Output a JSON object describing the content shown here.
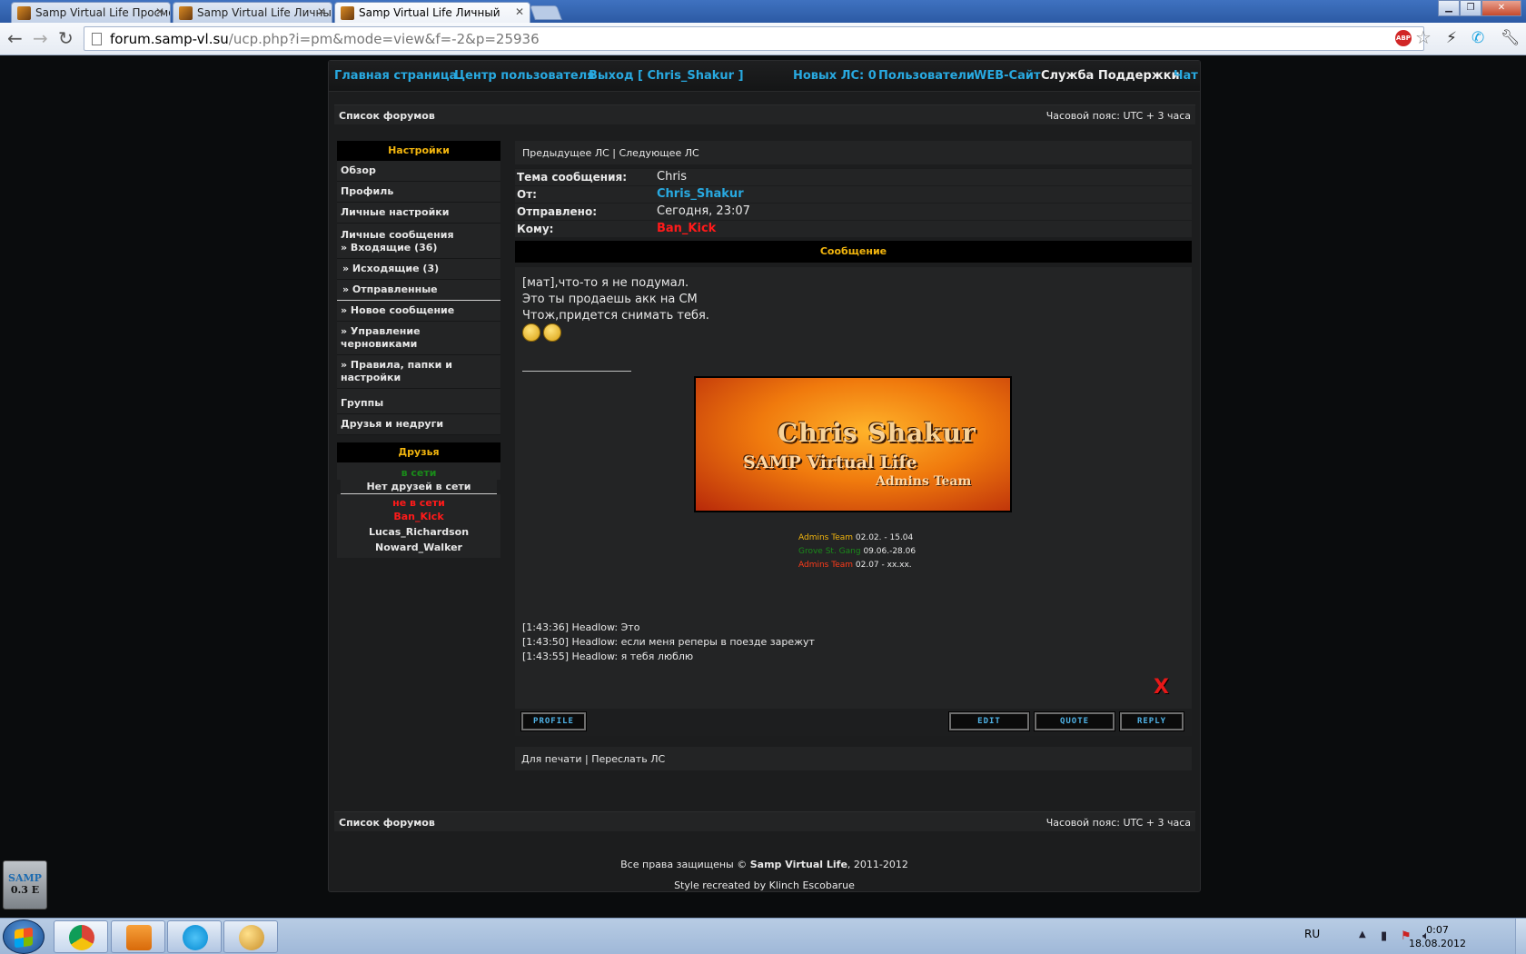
{
  "browser": {
    "tabs": [
      {
        "title": "Samp Virtual Life Просмот",
        "active": false
      },
      {
        "title": "Samp Virtual Life Личный",
        "active": false
      },
      {
        "title": "Samp Virtual Life Личный",
        "active": true
      }
    ],
    "url_host": "forum.samp-vl.su",
    "url_path": "/ucp.php?i=pm&mode=view&f=-2&p=25936",
    "abp_label": "ABP"
  },
  "topnav": {
    "home": "Главная страница",
    "ucp": "Центр пользователя",
    "logout": "Выход [ Chris_Shakur ]",
    "new_pm": "Новых ЛС: 0",
    "users": "Пользователи",
    "website": "WEB-Сайт",
    "support": "Служба Поддержки",
    "chat": "Чат"
  },
  "breadcrumb": {
    "forum_list": "Список форумов",
    "timezone": "Часовой пояс: UTC + 3 часа"
  },
  "sidebar": {
    "settings_header": "Настройки",
    "items": {
      "overview": "Обзор",
      "profile": "Профиль",
      "prefs": "Личные настройки",
      "pm": "Личные сообщения",
      "inbox": "» Входящие (36)",
      "outbox": "» Исходящие (3)",
      "sent": "» Отправленные",
      "compose": "» Новое сообщение",
      "drafts": "» Управление черновиками",
      "rules_1": "» Правила, папки и",
      "rules_2": "настройки",
      "groups": "Группы",
      "friends_foes": "Друзья и недруги"
    },
    "friends_header": "Друзья",
    "online_label": "в сети",
    "no_friends_online": "Нет друзей в сети",
    "offline_label": "не в сети",
    "offline_friends": [
      "Ban_Kick",
      "Lucas_Richardson",
      "Noward_Walker"
    ]
  },
  "message": {
    "nav": "Предыдущее ЛС | Следующее ЛС",
    "subject_label": "Тема сообщения:",
    "subject": "Chris",
    "from_label": "От:",
    "from": "Chris_Shakur",
    "sent_label": "Отправлено:",
    "sent": "Сегодня, 23:07",
    "to_label": "Кому:",
    "to": "Ban_Kick",
    "body_header": "Сообщение",
    "lines": [
      "[мат],что-то я не подумал.",
      "Это ты продаешь акк на СМ",
      "Чтож,придется снимать тебя."
    ],
    "banner": {
      "line1": "Chris Shakur",
      "line2": "SAMP Virtual Life",
      "line3": "Admins Team"
    },
    "signature": [
      {
        "label": "Admins Team",
        "dates": " 02.02. - 15.04",
        "color": "#f2b50e"
      },
      {
        "label": "Grove St. Gang",
        "dates": " 09.06.-28.06",
        "color": "#1a8a1a"
      },
      {
        "label": "Admins Team",
        "dates": " 02.07 - xx.xx.",
        "color": "#ff3b1a"
      }
    ],
    "chat": [
      "[1:43:36] Headlow: Это",
      "[1:43:50] Headlow: если меня реперы в поезде зарежут",
      "[1:43:55] Headlow: я тебя люблю"
    ],
    "delete_label": "X"
  },
  "buttons": {
    "profile": "PROFILE",
    "edit": "EDIT",
    "quote": "QUOTE",
    "reply": "REPLY"
  },
  "footer_links": "Для печати | Переслать ЛС",
  "copyright_prefix": "Все права защищены © ",
  "copyright_brand": "Samp Virtual Life",
  "copyright_suffix": ", 2011-2012",
  "style_credit": "Style recreated by Klinch Escobarue",
  "samp_logo": {
    "line1": "SAMP",
    "line2": "0.3 E"
  },
  "taskbar": {
    "lang": "RU",
    "time": "0:07",
    "date": "18.08.2012"
  },
  "colors": {
    "accent_blue": "#28a9e0",
    "header_gold": "#f2b50e",
    "online_green": "#1a8a1a",
    "offline_red": "#ff1a1a"
  }
}
